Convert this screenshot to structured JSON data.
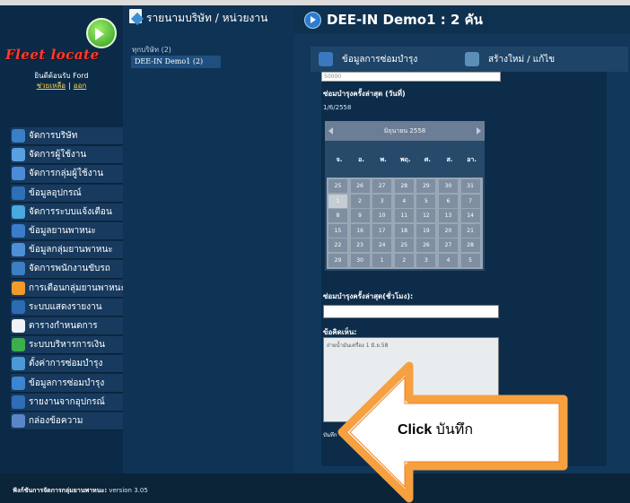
{
  "sidebar": {
    "welcome": "ยินดีต้อนรับ Ford",
    "help_link": "ช่วยเหลือ",
    "logout_link": "ออก",
    "items": [
      {
        "label": "จัดการบริษัท",
        "color": "#3a7fc8",
        "icon": "company-icon"
      },
      {
        "label": "จัดการผู้ใช้งาน",
        "color": "#5aa0e0",
        "icon": "user-icon"
      },
      {
        "label": "จัดการกลุ่มผู้ใช้งาน",
        "color": "#4c8cd6",
        "icon": "user-group-icon"
      },
      {
        "label": "ข้อมูลอุปกรณ์",
        "color": "#2e6fb7",
        "icon": "device-icon"
      },
      {
        "label": "จัดการระบบแจ้งเตือน",
        "color": "#49a9e0",
        "icon": "alert-icon"
      },
      {
        "label": "ข้อมูลยานพาหนะ",
        "color": "#3b7ccc",
        "icon": "vehicle-icon"
      },
      {
        "label": "ข้อมูลกลุ่มยานพาหนะ",
        "color": "#4d90d8",
        "icon": "vehicle-group-icon"
      },
      {
        "label": "จัดการพนักงานขับรถ",
        "color": "#3d7fc5",
        "icon": "driver-icon"
      },
      {
        "label": "การเตือนกลุ่มยานพาหนะ",
        "color": "#f29a2a",
        "icon": "warning-icon"
      },
      {
        "label": "ระบบแสดงรายงาน",
        "color": "#2c6cb4",
        "icon": "report-icon"
      },
      {
        "label": "ตารางกำหนดการ",
        "color": "#eef1f5",
        "icon": "schedule-icon"
      },
      {
        "label": "ระบบบริหารการเงิน",
        "color": "#3bb04a",
        "icon": "finance-icon"
      },
      {
        "label": "ตั้งค่าการซ่อมบำรุง",
        "color": "#4a9ad9",
        "icon": "maintenance-setting-icon"
      },
      {
        "label": "ข้อมูลการซ่อมบำรุง",
        "color": "#3c85d0",
        "icon": "maintenance-icon"
      },
      {
        "label": "รายงานจากอุปกรณ์",
        "color": "#2f6db5",
        "icon": "device-report-icon"
      },
      {
        "label": "กล่องข้อความ",
        "color": "#5a86c9",
        "icon": "inbox-icon"
      }
    ]
  },
  "footer": {
    "label": "ฟังก์ชันการจัดการกลุ่มยานพาหนะ:",
    "version": "version 3.05"
  },
  "company_panel": {
    "title": "รายนามบริษัท / หน่วยงาน",
    "all": "ทุกบริษัท (2)",
    "selected": "DEE-IN Demo1 (2)"
  },
  "detail": {
    "title": "DEE-IN Demo1 : 2 คัน",
    "tab_maintenance": "ข้อมูลการซ่อมบำรุง",
    "tab_create": "สร้างใหม่ / แก้ไข",
    "top_value": "50000",
    "last_maint_date_label": "ซ่อมบำรุงครั้งล่าสุด (วันที่)",
    "last_maint_date_value": "1/6/2558",
    "calendar_month": "มิถุนายน 2558",
    "dow": [
      "จ.",
      "อ.",
      "พ.",
      "พฤ.",
      "ศ.",
      "ส.",
      "อา."
    ],
    "days": [
      "25",
      "26",
      "27",
      "28",
      "29",
      "30",
      "31",
      "1",
      "2",
      "3",
      "4",
      "5",
      "6",
      "7",
      "8",
      "9",
      "10",
      "11",
      "12",
      "13",
      "14",
      "15",
      "16",
      "17",
      "18",
      "19",
      "20",
      "21",
      "22",
      "23",
      "24",
      "25",
      "26",
      "27",
      "28",
      "29",
      "30",
      "1",
      "2",
      "3",
      "4",
      "5"
    ],
    "last_maint_hours_label": "ซ่อมบำรุงครั้งล่าสุด(ชั่วโมง):",
    "notes_label": "ข้อคิดเห็น:",
    "notes_value": "ถ่ายน้ำมันเครื่อง 1 มิ.ย.58",
    "save_label": "บันทึก"
  },
  "callout": {
    "bold": "Click",
    "text": "บันทึก",
    "fill": "#ffffff",
    "stroke": "#f6a040"
  }
}
